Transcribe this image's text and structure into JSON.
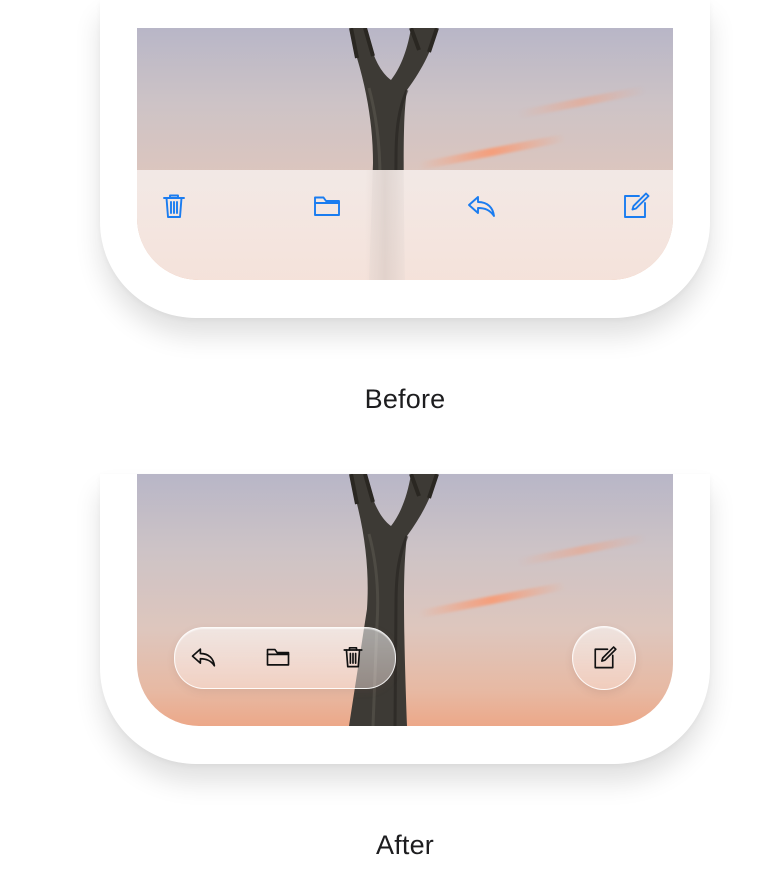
{
  "panels": {
    "before": {
      "caption": "Before",
      "toolbar": {
        "buttons": [
          {
            "icon": "trash-icon",
            "label": ""
          },
          {
            "icon": "folder-icon",
            "label": ""
          },
          {
            "icon": "reply-icon",
            "label": ""
          },
          {
            "icon": "compose-icon",
            "label": ""
          }
        ],
        "accent_color": "#1a7cf0"
      }
    },
    "after": {
      "caption": "After",
      "toolbar_group": [
        {
          "icon": "reply-icon"
        },
        {
          "icon": "folder-icon"
        },
        {
          "icon": "trash-icon"
        }
      ],
      "floating_button": {
        "icon": "compose-icon"
      },
      "icon_color": "#111111"
    }
  }
}
